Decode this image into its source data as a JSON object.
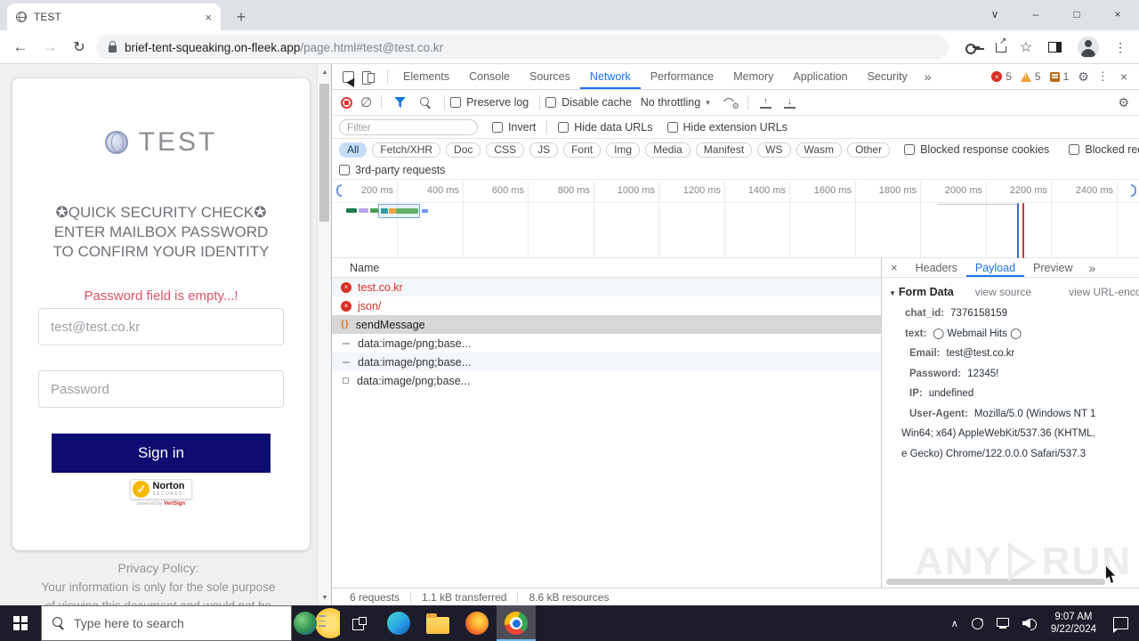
{
  "icons": {
    "close": "×",
    "new_tab": "+",
    "chevron_down": "∨",
    "minimize": "–",
    "maximize": "□",
    "back": "←",
    "forward": "→",
    "reload": "↻",
    "star": "☆",
    "kebab": "⋮",
    "gear": "⚙",
    "overflow": "»",
    "dropdown_caret": "▾",
    "disclosure_open": "▼",
    "scroll_up": "▲",
    "scroll_down": "▼",
    "tray_chevron": "∧",
    "clear": "∅",
    "error_x": "×",
    "bang": "!",
    "fetch_braces": "{}",
    "check": "✓",
    "up_arrow": "↑",
    "down_arrow": "↓"
  },
  "browser": {
    "tab_title": "TEST",
    "url": {
      "domain": "brief-tent-squeaking.on-fleek.app",
      "path": "/page.html#test@test.co.kr"
    }
  },
  "page": {
    "logo_text": "TEST",
    "heading1": "✪QUICK SECURITY CHECK✪",
    "heading2": "ENTER MAILBOX PASSWORD",
    "heading3": "TO CONFIRM YOUR IDENTITY",
    "error_message": "Password field is empty...!",
    "email_value": "test@test.co.kr",
    "password_placeholder": "Password",
    "signin_label": "Sign in",
    "norton_name": "Norton",
    "norton_secured": "SECURED",
    "norton_powered": "powered by",
    "norton_verisign": "VeriSign",
    "privacy1": "Privacy Policy:",
    "privacy2": "Your information is only for the sole purpose",
    "privacy3": "of viewing this document and would not be"
  },
  "devtools": {
    "tabs": [
      "Elements",
      "Console",
      "Sources",
      "Network",
      "Performance",
      "Memory",
      "Application",
      "Security"
    ],
    "badge_errors": "5",
    "badge_warnings": "5",
    "badge_issues": "1",
    "controls": {
      "preserve_log": "Preserve log",
      "disable_cache": "Disable cache",
      "throttling": "No throttling"
    },
    "filter_placeholder": "Filter",
    "invert": "Invert",
    "hide_data_urls": "Hide data URLs",
    "hide_extension_urls": "Hide extension URLs",
    "pills": [
      "All",
      "Fetch/XHR",
      "Doc",
      "CSS",
      "JS",
      "Font",
      "Img",
      "Media",
      "Manifest",
      "WS",
      "Wasm",
      "Other"
    ],
    "blocked_cookies": "Blocked response cookies",
    "blocked_requests": "Blocked requests",
    "third_party": "3rd-party requests",
    "ticks": [
      "200 ms",
      "400 ms",
      "600 ms",
      "800 ms",
      "1000 ms",
      "1200 ms",
      "1400 ms",
      "1600 ms",
      "1800 ms",
      "2000 ms",
      "2200 ms",
      "2400 ms"
    ],
    "name_header": "Name",
    "rows": [
      "test.co.kr",
      "json/",
      "sendMessage",
      "data:image/png;base...",
      "data:image/png;base...",
      "data:image/png;base..."
    ],
    "details": {
      "tab_headers": "Headers",
      "tab_payload": "Payload",
      "tab_preview": "Preview",
      "form_data": "Form Data",
      "view_source": "view source",
      "view_url_encoded": "view URL-encoded",
      "lines": [
        {
          "key": "chat_id:",
          "value": "7376158159"
        },
        {
          "key": "text:",
          "value": "◯ Webmail Hits ◯"
        },
        {
          "key": "Email:",
          "value": "test@test.co.kr"
        },
        {
          "key": "Password:",
          "value": "12345!"
        },
        {
          "key": "IP:",
          "value": "undefined"
        },
        {
          "key": "User-Agent:",
          "value": "Mozilla/5.0 (Windows NT 1"
        },
        {
          "key": "",
          "value": "Win64; x64) AppleWebKit/537.36 (KHTML,"
        },
        {
          "key": "",
          "value": "e Gecko) Chrome/122.0.0.0 Safari/537.3"
        }
      ]
    },
    "status": {
      "requests": "6 requests",
      "transferred": "1.1 kB transferred",
      "resources": "8.6 kB resources"
    }
  },
  "watermark": {
    "left": "ANY",
    "right": "RUN"
  },
  "taskbar": {
    "search_placeholder": "Type here to search",
    "time": "9:07 AM",
    "date": "9/22/2024"
  },
  "colors": {
    "accent_blue": "#1a73e8",
    "error_red": "#d93025",
    "warning_orange": "#f0a12c",
    "signin_navy": "#0c0c71",
    "norton_yellow": "#f8b800",
    "taskbar_bg": "#1c1c2a",
    "selected_row": "#d7d7d7"
  }
}
